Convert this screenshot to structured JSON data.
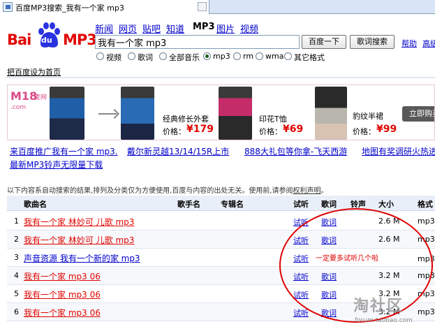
{
  "tab": {
    "title": "百度MP3搜索_我有一个家 mp3"
  },
  "logo": {
    "bai": "Bai",
    "du": "du",
    "mp3": "MP3"
  },
  "nav": [
    {
      "label": "新闻",
      "active": false
    },
    {
      "label": "网页",
      "active": false
    },
    {
      "label": "贴吧",
      "active": false
    },
    {
      "label": "知道",
      "active": false
    },
    {
      "label": "MP3",
      "active": true
    },
    {
      "label": "图片",
      "active": false
    },
    {
      "label": "视频",
      "active": false
    }
  ],
  "search": {
    "value": "我有一个家 mp3",
    "button": "百度一下",
    "lyrics_button": "歌词搜索",
    "help": "帮助",
    "advanced": "高级"
  },
  "filters": [
    {
      "label": "视频",
      "checked": false
    },
    {
      "label": "歌词",
      "checked": false
    },
    {
      "label": "全部音乐",
      "checked": false
    },
    {
      "label": "mp3",
      "checked": true
    },
    {
      "label": "rm",
      "checked": false
    },
    {
      "label": "wma",
      "checked": false
    },
    {
      "label": "其它格式",
      "checked": false
    }
  ],
  "sethome": "把百度设为首页",
  "banner": {
    "brand": "M18",
    "brand_sub": "麦网",
    "brand_url": ".com",
    "items": [
      {
        "name": "经典修长外套",
        "price_label": "价格：",
        "price": "¥179"
      },
      {
        "name": "印花T恤",
        "price_label": "价格：",
        "price": "¥69"
      },
      {
        "name": "豹纹半裙",
        "price_label": "价格：",
        "price": "¥99"
      }
    ],
    "buy": "立即购买"
  },
  "promos": [
    "来百度推广我有一个家 mp3.",
    "戴尔新灵越13/14/15R上市",
    "888大礼包等你拿-飞天西游",
    "地图有奖调研火热进行",
    "最新MP3铃声无限量下载"
  ],
  "notice": {
    "text": "以下内容系自动搜索的结果,排列及分类仅为方便使用,百度与内容的出处无关。使用前,请参阅",
    "link": "权利声明",
    "end": "。"
  },
  "table": {
    "headers": [
      "歌曲名",
      "歌手名",
      "专辑名",
      "试听",
      "歌词",
      "铃声",
      "大小",
      "格式"
    ],
    "rows": [
      {
        "num": "1",
        "song": "我有一个家 林妙可 儿歌 mp3",
        "try": "试听",
        "lyric": "歌词",
        "size": "2.6 M",
        "fmt": "mp3"
      },
      {
        "num": "2",
        "song": "我有一个家 林妙可 儿歌 mp3",
        "try": "试听",
        "lyric": "歌词",
        "size": "2.6 M",
        "fmt": "mp3"
      },
      {
        "num": "3",
        "song": "声音资源 我有一个新的家 mp3",
        "try": "试听",
        "lyric": "",
        "size": "",
        "fmt": "mp3"
      },
      {
        "num": "4",
        "song": "我有一个家 mp3 06",
        "try": "试听",
        "lyric": "歌词",
        "size": "3.2 M",
        "fmt": "mp3"
      },
      {
        "num": "5",
        "song": "我有一个家 mp3 06",
        "try": "试听",
        "lyric": "歌词",
        "size": "3.2 M",
        "fmt": "mp3"
      },
      {
        "num": "6",
        "song": "我有一个家 mp3 06",
        "try": "试听",
        "lyric": "歌词",
        "size": "3.2 M",
        "fmt": "mp3"
      }
    ]
  },
  "annotation": "一定要多试听几个啦",
  "watermark": {
    "logo": "淘社区",
    "url": "forum.taobao.com"
  },
  "colors": {
    "brand_red": "#e10602",
    "link_blue": "#0000cc",
    "annotation_red": "#e00000"
  }
}
